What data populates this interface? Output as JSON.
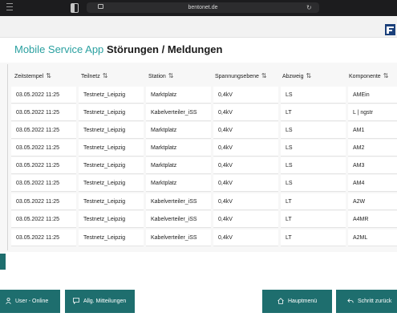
{
  "browser": {
    "url": "bentonet.de"
  },
  "header": {
    "app_title": "Mobile Service App",
    "page_title": "Störungen / Meldungen"
  },
  "table": {
    "columns": [
      "Zeitstempel",
      "Teilnetz",
      "Station",
      "Spannungsebene",
      "Abzweig",
      "Komponente"
    ],
    "rows": [
      [
        "03.05.2022 11:25",
        "Testnetz_Leipzig",
        "Marktplatz",
        "0,4kV",
        "LS",
        "AMEin"
      ],
      [
        "03.05.2022 11:25",
        "Testnetz_Leipzig",
        "Kabelverteiler_iSS",
        "0,4kV",
        "LT",
        "L | ngstr"
      ],
      [
        "03.05.2022 11:25",
        "Testnetz_Leipzig",
        "Marktplatz",
        "0,4kV",
        "LS",
        "AM1"
      ],
      [
        "03.05.2022 11:25",
        "Testnetz_Leipzig",
        "Marktplatz",
        "0,4kV",
        "LS",
        "AM2"
      ],
      [
        "03.05.2022 11:25",
        "Testnetz_Leipzig",
        "Marktplatz",
        "0,4kV",
        "LS",
        "AM3"
      ],
      [
        "03.05.2022 11:25",
        "Testnetz_Leipzig",
        "Marktplatz",
        "0,4kV",
        "LS",
        "AM4"
      ],
      [
        "03.05.2022 11:25",
        "Testnetz_Leipzig",
        "Kabelverteiler_iSS",
        "0,4kV",
        "LT",
        "A2W"
      ],
      [
        "03.05.2022 11:25",
        "Testnetz_Leipzig",
        "Kabelverteiler_iSS",
        "0,4kV",
        "LT",
        "A4MR"
      ],
      [
        "03.05.2022 11:25",
        "Testnetz_Leipzig",
        "Kabelverteiler_iSS",
        "0,4kV",
        "LT",
        "A2ML"
      ]
    ]
  },
  "footer": {
    "user_status": "User - Online",
    "messages": "Allg. Mitteilungen",
    "main_menu": "Hauptmenü",
    "step_back": "Schritt zurück"
  },
  "colors": {
    "accent": "#2aa0a0",
    "button_bg": "#1e6e6e"
  },
  "icons": [
    "sidebar-icon",
    "tab-icon",
    "lock-icon",
    "reload-icon",
    "sort-icon",
    "user-icon",
    "message-icon",
    "home-icon",
    "back-arrow-icon"
  ]
}
